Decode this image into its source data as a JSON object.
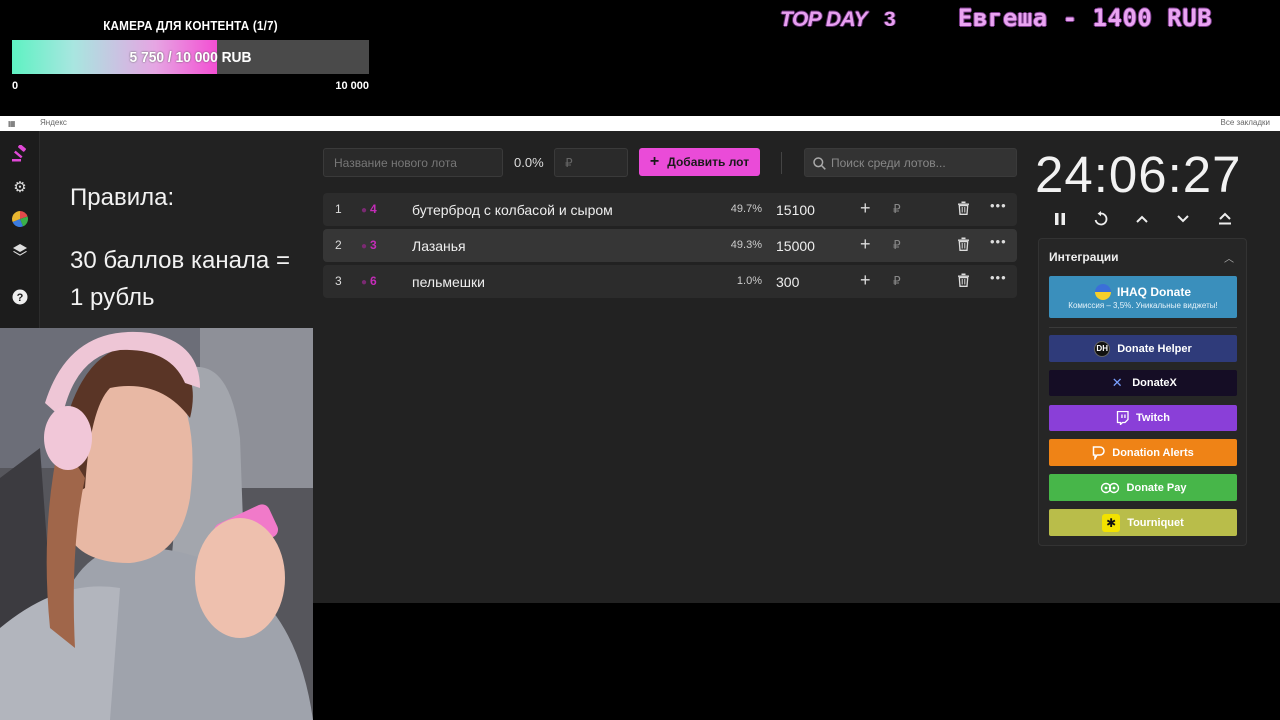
{
  "overlay": {
    "goal_title": "КАМЕРА ДЛЯ КОНТЕНТА (1/7)",
    "goal_amount": "5 750 / 10 000 RUB",
    "goal_progress": 0.575,
    "goal_min": "0",
    "goal_max": "10 000",
    "topday_label": "TOP DAY",
    "topday_rank": "3",
    "top_donor": "Евгеша - 1400 RUB"
  },
  "browser": {
    "bookmark_yandex": "Яндекс",
    "all_bookmarks": "Все закладки"
  },
  "rules": {
    "title": "Правила:",
    "line1": "30 баллов канала =",
    "line2": "1 рубль"
  },
  "toolbar": {
    "lot_placeholder": "Название нового лота",
    "percent": "0.0%",
    "amount_placeholder": "₽",
    "add_label": "Добавить лот",
    "search_placeholder": "Поиск среди лотов..."
  },
  "lots": [
    {
      "num": "1",
      "votes": "4",
      "name": "бутерброд с колбасой и сыром",
      "share": "49.7%",
      "sum": "15100"
    },
    {
      "num": "2",
      "votes": "3",
      "name": "Лазанья",
      "share": "49.3%",
      "sum": "15000"
    },
    {
      "num": "3",
      "votes": "6",
      "name": "пельмешки",
      "share": "1.0%",
      "sum": "300"
    }
  ],
  "lot_currency": "₽",
  "timer": {
    "value": "24:06:27"
  },
  "integrations": {
    "title": "Интеграции",
    "ihaq_label": "IHAQ Donate",
    "ihaq_sub": "Комиссия – 3,5%. Уникальные виджеты!",
    "buttons": [
      {
        "label": "Donate Helper",
        "color": "#2f3b7a"
      },
      {
        "label": "DonateX",
        "color": "#150d25"
      },
      {
        "label": "Twitch",
        "color": "#8a3fd8"
      },
      {
        "label": "Donation Alerts",
        "color": "#ef8316"
      },
      {
        "label": "Donate Pay",
        "color": "#47b649"
      },
      {
        "label": "Tourniquet",
        "color": "#b9bd4a"
      }
    ]
  },
  "colors": {
    "accent": "#ea4bd8",
    "app_bg": "#222222"
  }
}
